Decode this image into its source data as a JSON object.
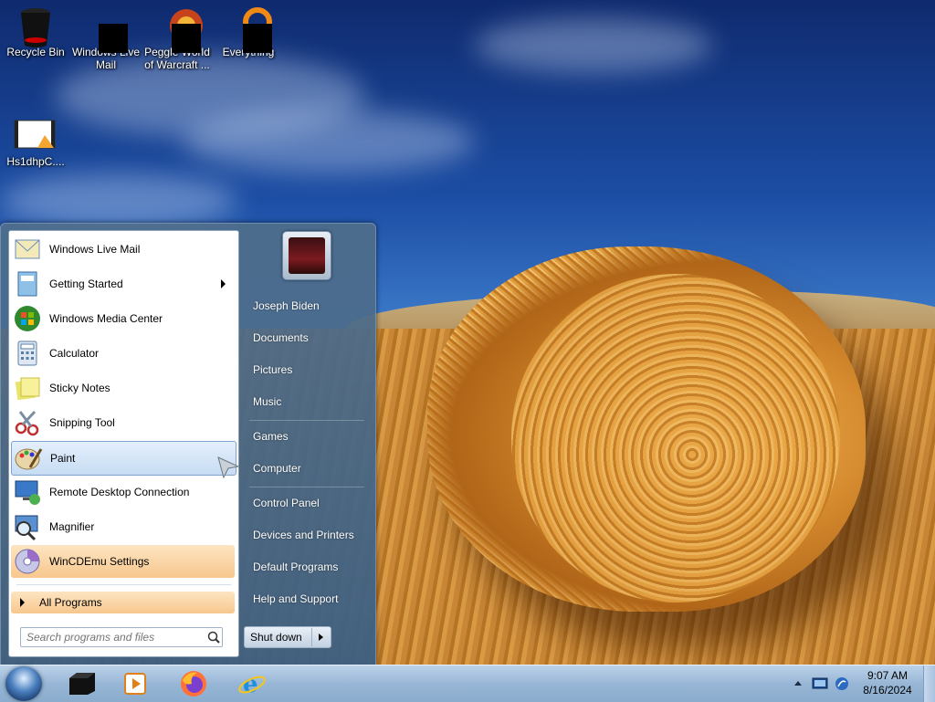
{
  "desktop": {
    "icons": [
      {
        "label": "Recycle Bin"
      },
      {
        "label": "Windows Live Mail"
      },
      {
        "label": "Peggle World of Warcraft ..."
      },
      {
        "label": "Everything"
      },
      {
        "label": "Hs1dhpC...."
      }
    ]
  },
  "start_menu": {
    "programs": [
      {
        "label": "Windows Live Mail"
      },
      {
        "label": "Getting Started"
      },
      {
        "label": "Windows Media Center"
      },
      {
        "label": "Calculator"
      },
      {
        "label": "Sticky Notes"
      },
      {
        "label": "Snipping Tool"
      },
      {
        "label": "Paint"
      },
      {
        "label": "Remote Desktop Connection"
      },
      {
        "label": "Magnifier"
      },
      {
        "label": "WinCDEmu Settings"
      }
    ],
    "all_programs": "All Programs",
    "search_placeholder": "Search programs and files",
    "right_items": [
      {
        "label": "Joseph Biden"
      },
      {
        "label": "Documents"
      },
      {
        "label": "Pictures"
      },
      {
        "label": "Music"
      },
      {
        "label": "Games"
      },
      {
        "label": "Computer"
      },
      {
        "label": "Control Panel"
      },
      {
        "label": "Devices and Printers"
      },
      {
        "label": "Default Programs"
      },
      {
        "label": "Help and Support"
      }
    ],
    "shutdown": "Shut down"
  },
  "taskbar": {
    "pinned": [
      "file-explorer-icon",
      "media-player-icon",
      "firefox-icon",
      "internet-explorer-icon"
    ],
    "clock": {
      "time": "9:07 AM",
      "date": "8/16/2024"
    }
  }
}
